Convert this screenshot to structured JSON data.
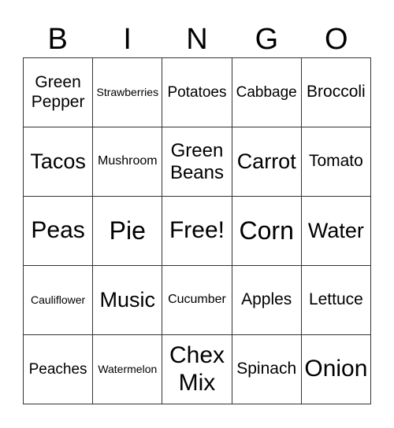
{
  "header": [
    "B",
    "I",
    "N",
    "G",
    "O"
  ],
  "cells": [
    [
      "Green Pepper",
      "Strawberries",
      "Potatoes",
      "Cabbage",
      "Broccoli"
    ],
    [
      "Tacos",
      "Mushroom",
      "Green Beans",
      "Carrot",
      "Tomato"
    ],
    [
      "Peas",
      "Pie",
      "Free!",
      "Corn",
      "Water"
    ],
    [
      "Cauliflower",
      "Music",
      "Cucumber",
      "Apples",
      "Lettuce"
    ],
    [
      "Peaches",
      "Watermelon",
      "Chex Mix",
      "Spinach",
      "Onion"
    ]
  ]
}
